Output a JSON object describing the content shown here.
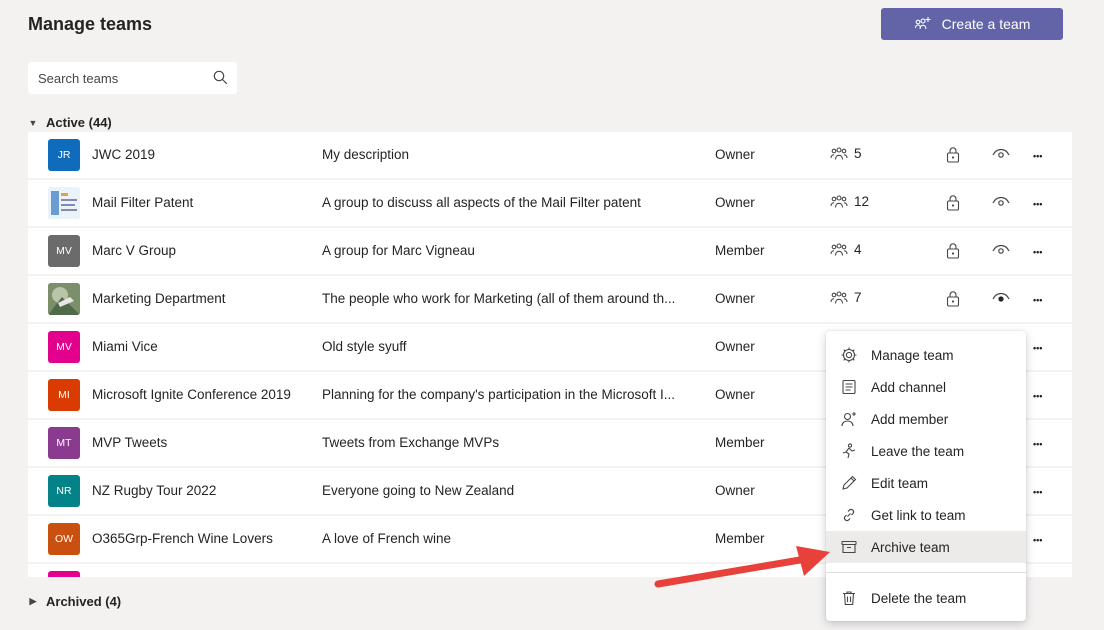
{
  "header": {
    "title": "Manage teams",
    "create_label": "Create a team"
  },
  "search": {
    "placeholder": "Search teams"
  },
  "sections": {
    "active": "Active (44)",
    "archived": "Archived (4)"
  },
  "teams": [
    {
      "initials": "JR",
      "color": "#0f6cbd",
      "name": "JWC 2019",
      "description": "My description",
      "role": "Owner",
      "members": "5",
      "eye_filled": false
    },
    {
      "initials": "",
      "color": "#d0e4f5",
      "name": "Mail Filter Patent",
      "description": "A group to discuss all aspects of the Mail Filter patent",
      "role": "Owner",
      "members": "12",
      "eye_filled": false
    },
    {
      "initials": "MV",
      "color": "#6b6b6b",
      "name": "Marc V Group",
      "description": "A group for Marc Vigneau",
      "role": "Member",
      "members": "4",
      "eye_filled": false
    },
    {
      "initials": "",
      "color": "#5a7a5c",
      "name": "Marketing Department",
      "description": "The people who work for Marketing (all of them around th...",
      "role": "Owner",
      "members": "7",
      "eye_filled": true
    },
    {
      "initials": "MV",
      "color": "#e3008c",
      "name": "Miami Vice",
      "description": "Old style syuff",
      "role": "Owner"
    },
    {
      "initials": "MI",
      "color": "#da3b01",
      "name": "Microsoft Ignite Conference 2019",
      "description": "Planning for the company's participation in the Microsoft I...",
      "role": "Owner"
    },
    {
      "initials": "MT",
      "color": "#8a3b8f",
      "name": "MVP Tweets",
      "description": "Tweets from Exchange MVPs",
      "role": "Member"
    },
    {
      "initials": "NR",
      "color": "#038387",
      "name": "NZ Rugby Tour 2022",
      "description": "Everyone going to New Zealand",
      "role": "Owner"
    },
    {
      "initials": "OW",
      "color": "#ca5010",
      "name": "O365Grp-French Wine Lovers",
      "description": "A love of French wine",
      "role": "Member"
    },
    {
      "initials": "",
      "color": "#e3008c",
      "name": "",
      "description": "",
      "role": ""
    }
  ],
  "context_menu": {
    "items": [
      {
        "label": "Manage team",
        "icon": "gear-icon"
      },
      {
        "label": "Add channel",
        "icon": "channel-icon"
      },
      {
        "label": "Add member",
        "icon": "add-person-icon"
      },
      {
        "label": "Leave the team",
        "icon": "leave-icon"
      },
      {
        "label": "Edit team",
        "icon": "pencil-icon"
      },
      {
        "label": "Get link to team",
        "icon": "link-icon"
      },
      {
        "label": "Archive team",
        "icon": "archive-icon"
      }
    ],
    "delete_label": "Delete the team",
    "highlighted": "Archive team"
  },
  "colors": {
    "accent": "#6264a7",
    "annotation_arrow": "#e8413b"
  }
}
